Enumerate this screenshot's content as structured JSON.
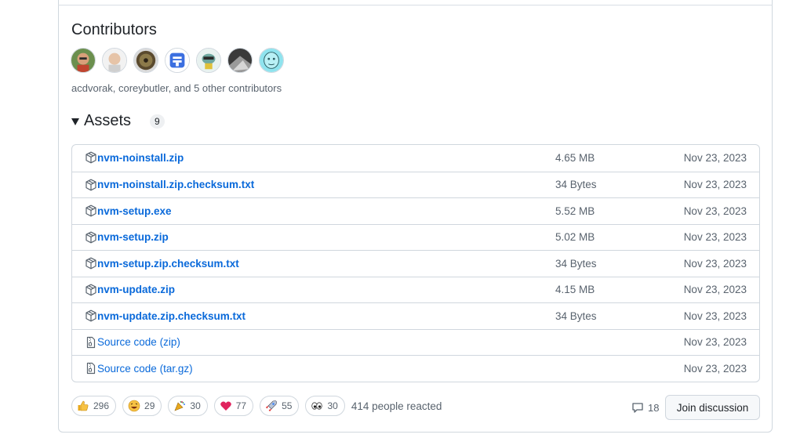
{
  "contributors": {
    "title": "Contributors",
    "summary": "acdvorak, coreybutler, and 5 other contributors",
    "avatars": [
      "avatar-1",
      "avatar-2",
      "avatar-3",
      "avatar-4",
      "avatar-5",
      "avatar-6",
      "avatar-7"
    ]
  },
  "assets": {
    "title": "Assets",
    "count": "9",
    "items": [
      {
        "name": "nvm-noinstall.zip",
        "size": "4.65 MB",
        "date": "Nov 23, 2023",
        "icon": "package-icon"
      },
      {
        "name": "nvm-noinstall.zip.checksum.txt",
        "size": "34 Bytes",
        "date": "Nov 23, 2023",
        "icon": "package-icon"
      },
      {
        "name": "nvm-setup.exe",
        "size": "5.52 MB",
        "date": "Nov 23, 2023",
        "icon": "package-icon"
      },
      {
        "name": "nvm-setup.zip",
        "size": "5.02 MB",
        "date": "Nov 23, 2023",
        "icon": "package-icon"
      },
      {
        "name": "nvm-setup.zip.checksum.txt",
        "size": "34 Bytes",
        "date": "Nov 23, 2023",
        "icon": "package-icon"
      },
      {
        "name": "nvm-update.zip",
        "size": "4.15 MB",
        "date": "Nov 23, 2023",
        "icon": "package-icon"
      },
      {
        "name": "nvm-update.zip.checksum.txt",
        "size": "34 Bytes",
        "date": "Nov 23, 2023",
        "icon": "package-icon"
      },
      {
        "name": "Source code",
        "suffix": "(zip)",
        "size": "",
        "date": "Nov 23, 2023",
        "icon": "file-zip-icon"
      },
      {
        "name": "Source code",
        "suffix": "(tar.gz)",
        "size": "",
        "date": "Nov 23, 2023",
        "icon": "file-zip-icon"
      }
    ]
  },
  "reactions": {
    "items": [
      {
        "emoji": "thumbs-up-icon",
        "count": "296"
      },
      {
        "emoji": "laugh-icon",
        "count": "29"
      },
      {
        "emoji": "hooray-icon",
        "count": "30"
      },
      {
        "emoji": "heart-icon",
        "count": "77"
      },
      {
        "emoji": "rocket-icon",
        "count": "55"
      },
      {
        "emoji": "eyes-icon",
        "count": "30"
      }
    ],
    "summary": "414 people reacted"
  },
  "discussion": {
    "comments": "18",
    "button_label": "Join discussion"
  },
  "colors": {
    "link": "#0969da",
    "muted": "#59636e",
    "border": "#d0d7de"
  }
}
